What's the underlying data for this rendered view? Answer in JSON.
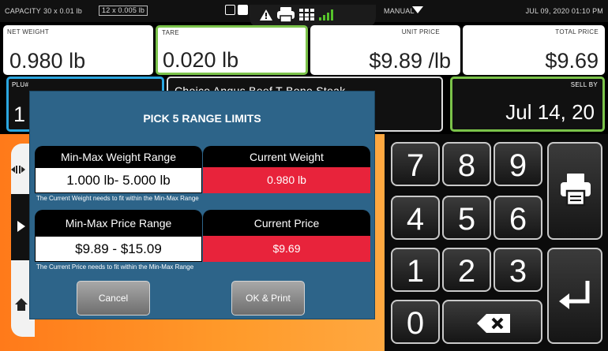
{
  "status": {
    "capacity_label": "CAPACITY",
    "capacity_value": "30 x 0.01 lb",
    "capacity_boxed": "12 x 0.005 lb",
    "mode": "MANUAL",
    "datetime": "JUL 09, 2020 01:10 PM"
  },
  "fields": {
    "net_weight": {
      "label": "NET WEIGHT",
      "value": "0.980 lb"
    },
    "tare": {
      "label": "TARE",
      "value": "0.020 lb"
    },
    "unit_price": {
      "label": "UNIT PRICE",
      "value": "$9.89 /lb"
    },
    "total_price": {
      "label": "TOTAL PRICE",
      "value": "$9.69"
    },
    "plu": {
      "label": "PLU#",
      "value": "1"
    },
    "product": "Choice Angus Beef T-Bone Steak",
    "sell_by": {
      "label": "SELL BY",
      "value": "Jul 14, 20"
    }
  },
  "keypad": {
    "keys": [
      "7",
      "8",
      "9",
      "4",
      "5",
      "6",
      "1",
      "2",
      "3",
      "0"
    ],
    "icons": {
      "print": "printer-icon",
      "enter": "enter-icon",
      "backspace": "backspace-icon"
    }
  },
  "modal": {
    "title": "PICK 5  RANGE LIMITS",
    "weight_header": "Min-Max Weight Range",
    "weight_range": "1.000 lb- 5.000 lb",
    "current_weight_header": "Current Weight",
    "current_weight": "0.980 lb",
    "weight_note": "The Current Weight needs to fit within the Min-Max Range",
    "price_header": "Min-Max Price Range",
    "price_range": "$9.89 - $15.09",
    "current_price_header": "Current Price",
    "current_price": "$9.69",
    "price_note": "The Current Price needs to fit within the Min-Max Range",
    "cancel": "Cancel",
    "ok": "OK & Print"
  },
  "colors": {
    "accent_green": "#7bc34a",
    "accent_red": "#e8233b",
    "modal_blue": "#2d6489",
    "highlight_blue": "#2aa6e0",
    "background_orange": "#ff8a22"
  }
}
